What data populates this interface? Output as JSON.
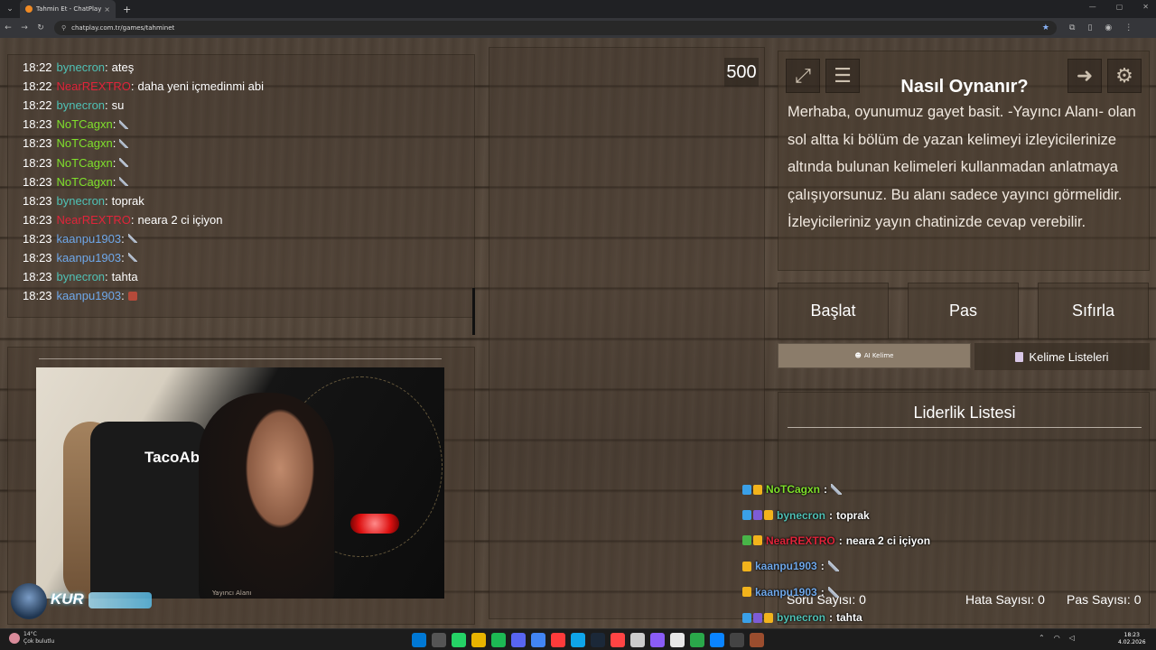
{
  "browser": {
    "tab_title": "Tahmin Et - ChatPlay",
    "url": "chatplay.com.tr/games/tahminet"
  },
  "chat": {
    "messages": [
      {
        "time": "18:22",
        "user": "bynecron",
        "color": "#4fc1b5",
        "text": "ateş",
        "icon": ""
      },
      {
        "time": "18:22",
        "user": "NearREXTRO",
        "color": "#e0243a",
        "text": "daha yeni içmedinmi abi",
        "icon": ""
      },
      {
        "time": "18:22",
        "user": "bynecron",
        "color": "#4fc1b5",
        "text": "su",
        "icon": ""
      },
      {
        "time": "18:23",
        "user": "NoTCagxn",
        "color": "#7fe02b",
        "text": "",
        "icon": "sword"
      },
      {
        "time": "18:23",
        "user": "NoTCagxn",
        "color": "#7fe02b",
        "text": "",
        "icon": "sword"
      },
      {
        "time": "18:23",
        "user": "NoTCagxn",
        "color": "#7fe02b",
        "text": "",
        "icon": "sword"
      },
      {
        "time": "18:23",
        "user": "NoTCagxn",
        "color": "#7fe02b",
        "text": "",
        "icon": "sword"
      },
      {
        "time": "18:23",
        "user": "bynecron",
        "color": "#4fc1b5",
        "text": "toprak",
        "icon": ""
      },
      {
        "time": "18:23",
        "user": "NearREXTRO",
        "color": "#e0243a",
        "text": "neara 2 ci içiyon",
        "icon": ""
      },
      {
        "time": "18:23",
        "user": "kaanpu1903",
        "color": "#6fa8ea",
        "text": "",
        "icon": "sword"
      },
      {
        "time": "18:23",
        "user": "kaanpu1903",
        "color": "#6fa8ea",
        "text": "",
        "icon": "sword"
      },
      {
        "time": "18:23",
        "user": "bynecron",
        "color": "#4fc1b5",
        "text": "tahta",
        "icon": ""
      },
      {
        "time": "18:23",
        "user": "kaanpu1903",
        "color": "#6fa8ea",
        "text": "",
        "icon": "box"
      }
    ]
  },
  "webcam": {
    "chair_text": "TacoAbi",
    "caption": "Yayıncı Alanı"
  },
  "logo": {
    "name": "KUR"
  },
  "score": "500",
  "howto": {
    "title": "Nasıl Oynanır?",
    "text": "Merhaba, oyunumuz gayet basit. -Yayıncı Alanı- olan sol altta ki bölüm de yazan kelimeyi izleyicilerinize altında bulunan kelimeleri kullanmadan anlatmaya çalışıyorsunuz. Bu alanı sadece yayıncı görmelidir. İzleyicileriniz yayın chatinizde cevap verebilir."
  },
  "controls": {
    "start": "Başlat",
    "pass": "Pas",
    "reset": "Sıfırla"
  },
  "tabs": {
    "ai": "AI Kelime",
    "lists": "Kelime Listeleri"
  },
  "leaderboard": {
    "title": "Liderlik Listesi"
  },
  "stats": {
    "questions": "Soru Sayısı: 0",
    "misses": "Hata Sayısı: 0",
    "passes": "Pas Sayısı: 0"
  },
  "overlay_chat": [
    {
      "badges": [
        "blue",
        "gold"
      ],
      "user": "NoTCagxn",
      "color": "#7fe02b",
      "text": "",
      "icon": "sword"
    },
    {
      "badges": [
        "blue",
        "purple",
        "gold"
      ],
      "user": "bynecron",
      "color": "#4fc1b5",
      "text": "toprak",
      "icon": ""
    },
    {
      "badges": [
        "green",
        "gold"
      ],
      "user": "NearREXTRO",
      "color": "#e0243a",
      "text": "neara 2 ci içiyon",
      "icon": ""
    },
    {
      "badges": [
        "gold"
      ],
      "user": "kaanpu1903",
      "color": "#6fa8ea",
      "text": "",
      "icon": "sword"
    },
    {
      "badges": [
        "gold"
      ],
      "user": "kaanpu1903",
      "color": "#6fa8ea",
      "text": "",
      "icon": "sword"
    },
    {
      "badges": [
        "blue",
        "purple",
        "gold"
      ],
      "user": "bynecron",
      "color": "#4fc1b5",
      "text": "tahta",
      "icon": ""
    },
    {
      "badges": [
        "gold"
      ],
      "user": "kaanpu1903",
      "color": "#6fa8ea",
      "text": "",
      "icon": "box"
    }
  ],
  "taskbar": {
    "weather_temp": "14°C",
    "weather_text": "Çok bulutlu",
    "time": "18:23",
    "date": "4.02.2026",
    "app_colors": [
      "#0078d4",
      "#555",
      "#25d366",
      "#e8b400",
      "#1db954",
      "#5865f2",
      "#4285f4",
      "#ff3b3b",
      "#0fa5e9",
      "#1b2838",
      "#ff4444",
      "#cccccc",
      "#8a5cf6",
      "#e8e8e8",
      "#2aa84a",
      "#0a84ff",
      "#444444",
      "#9b4d2e"
    ]
  }
}
